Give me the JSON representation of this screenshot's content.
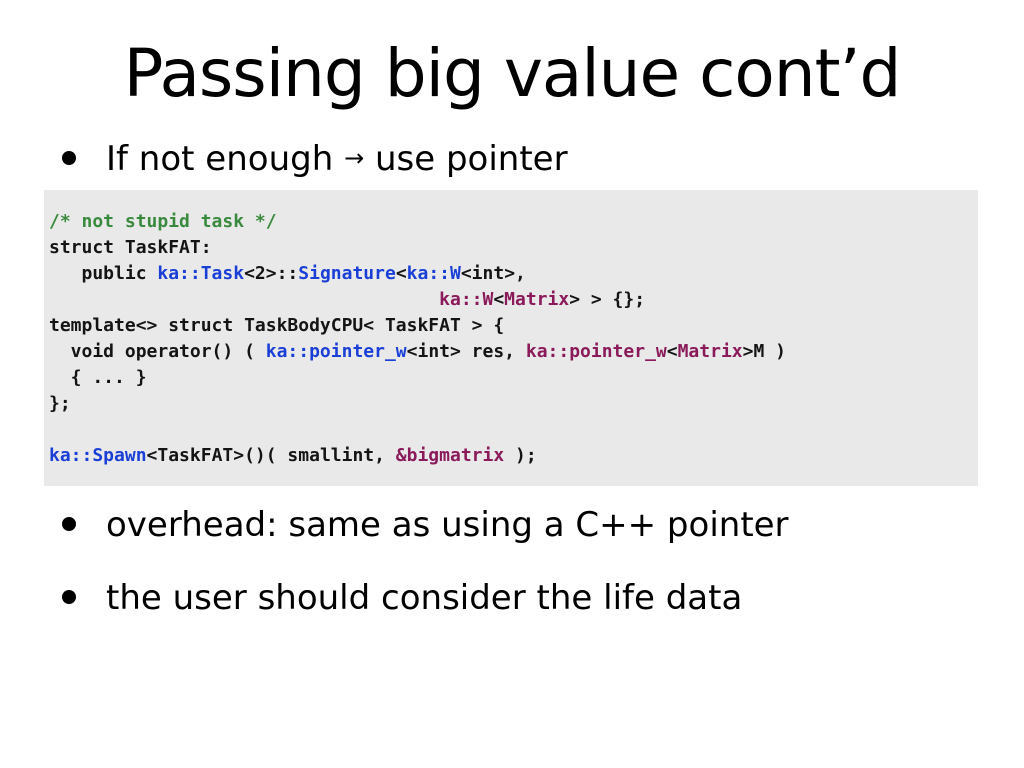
{
  "slide": {
    "title": "Passing big value cont’d",
    "bullets": [
      {
        "pre": "If not enough",
        "arrow": "→",
        "post": "use pointer"
      },
      {
        "text": "overhead: same as using a C++ pointer"
      },
      {
        "text": "the user should consider the life data"
      }
    ]
  },
  "code": {
    "lines": [
      [
        {
          "t": "/* not stupid task */",
          "k": "comment"
        }
      ],
      [
        {
          "t": "struct TaskFAT:",
          "k": "plain"
        }
      ],
      [
        {
          "t": "   public ",
          "k": "plain"
        },
        {
          "t": "ka::Task",
          "k": "ns"
        },
        {
          "t": "<2>::",
          "k": "plain"
        },
        {
          "t": "Signature",
          "k": "ns"
        },
        {
          "t": "<",
          "k": "plain"
        },
        {
          "t": "ka::W",
          "k": "ns"
        },
        {
          "t": "<int>,",
          "k": "plain"
        }
      ],
      [
        {
          "t": "                                    ",
          "k": "plain"
        },
        {
          "t": "ka::W",
          "k": "type"
        },
        {
          "t": "<",
          "k": "plain"
        },
        {
          "t": "Matrix",
          "k": "type"
        },
        {
          "t": "> > {};",
          "k": "plain"
        }
      ],
      [
        {
          "t": "template<> struct TaskBodyCPU< TaskFAT > {",
          "k": "plain"
        }
      ],
      [
        {
          "t": "  void operator() ( ",
          "k": "plain"
        },
        {
          "t": "ka::pointer_w",
          "k": "ns"
        },
        {
          "t": "<int> res, ",
          "k": "plain"
        },
        {
          "t": "ka::pointer_w",
          "k": "type"
        },
        {
          "t": "<",
          "k": "plain"
        },
        {
          "t": "Matrix",
          "k": "type"
        },
        {
          "t": ">M )",
          "k": "plain"
        }
      ],
      [
        {
          "t": "  { ... }",
          "k": "plain"
        }
      ],
      [
        {
          "t": "};",
          "k": "plain"
        }
      ],
      [
        {
          "t": "",
          "k": "plain"
        }
      ],
      [
        {
          "t": "ka::Spawn",
          "k": "ns"
        },
        {
          "t": "<TaskFAT>()( smallint, ",
          "k": "plain"
        },
        {
          "t": "&bigmatrix",
          "k": "type"
        },
        {
          "t": " );",
          "k": "plain"
        }
      ]
    ]
  },
  "colors": {
    "background": "#ffffff",
    "code_background": "#e9e9e9",
    "comment": "#3a8a3e",
    "namespace": "#1a3fd6",
    "type": "#8a1a5a",
    "text": "#141414"
  }
}
